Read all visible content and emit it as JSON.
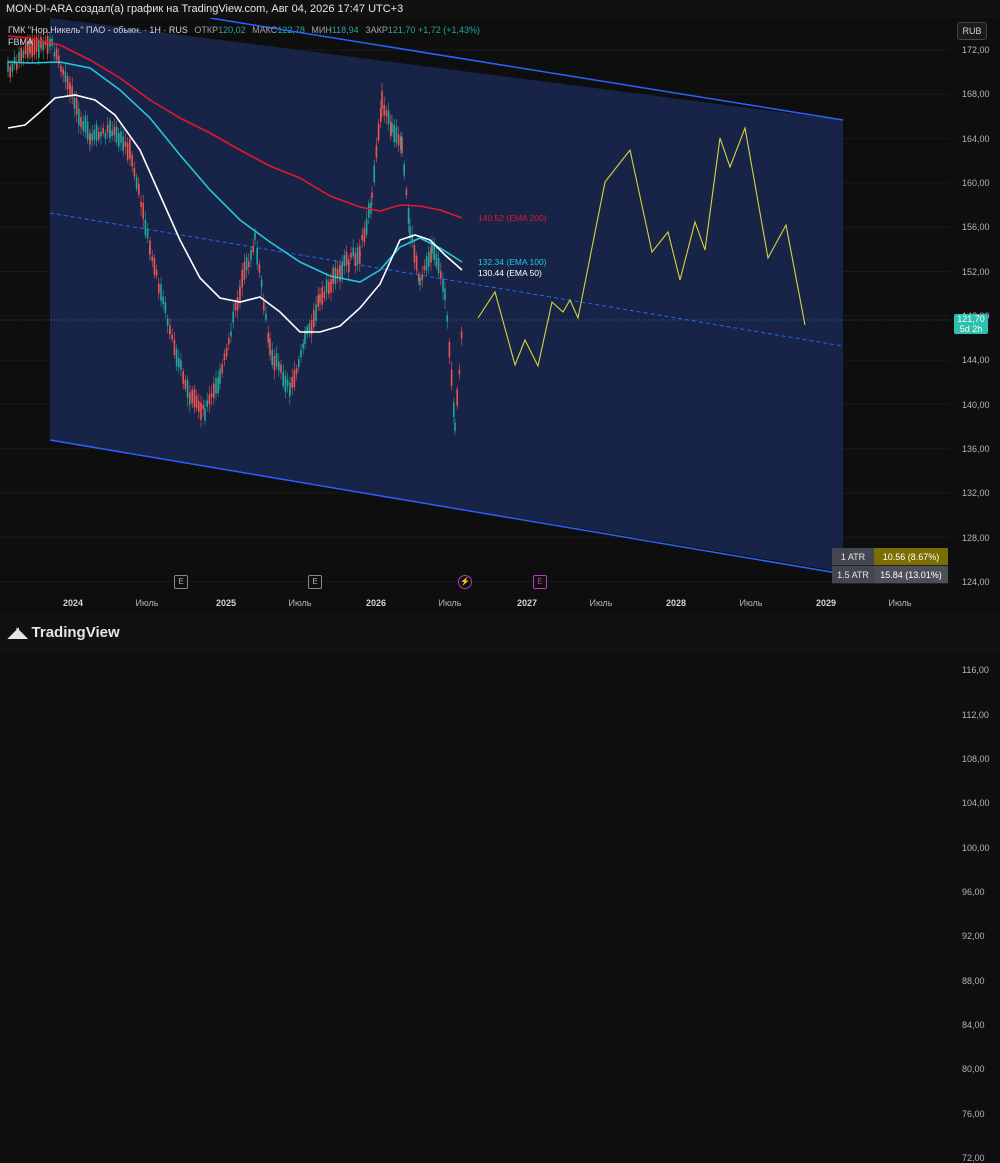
{
  "header": {
    "title": "MON-DI-ARA создал(а) график на TradingView.com, Авг 04, 2026 17:47 UTC+3"
  },
  "legend": {
    "symbol": "ГМК \"Нор.Никель\" ПАО - обыкн. · 1Н · RUS",
    "open_label": "ОТКР",
    "open": "120,02",
    "high_label": "МАКС",
    "high": "122,78",
    "low_label": "МИН",
    "low": "118,94",
    "close_label": "ЗАКР",
    "close": "121,70",
    "change": "+1,72 (+1,43%)",
    "indicator": "FBMA"
  },
  "currency_button": "RUB",
  "price_axis": [
    "172,00",
    "168,00",
    "164,00",
    "160,00",
    "156,00",
    "152,00",
    "148,00",
    "144,00",
    "140,00",
    "136,00",
    "132,00",
    "128,00",
    "124,00",
    "116,00",
    "112,00",
    "108,00",
    "104,00",
    "100,00",
    "96,00",
    "92,00",
    "88,00",
    "84,00",
    "80,00",
    "76,00",
    "72,00"
  ],
  "last_price": {
    "value": "121,70",
    "countdown": "5d 2h",
    "color": "#2ebfae"
  },
  "time_axis": [
    "2024",
    "Июль",
    "2025",
    "Июль",
    "2026",
    "Июль",
    "2027",
    "Июль",
    "2028",
    "Июль",
    "2029",
    "Июль"
  ],
  "ema_labels": {
    "ema200": "140.52 (EMA 200)",
    "ema100": "132.34 (EMA 100)",
    "ema50": "130.44 (EMA 50)"
  },
  "colors": {
    "ema200": "#e5172b",
    "ema100": "#26c6da",
    "ema50": "#ffffff",
    "channel": "#2962ff",
    "channel_fill": "#172447",
    "projection": "#d6d33a",
    "up": "#26a69a",
    "down": "#ef5350"
  },
  "events": [
    {
      "icon": "earnings-icon",
      "glyph": "E"
    },
    {
      "icon": "earnings-icon",
      "glyph": "E"
    },
    {
      "icon": "bolt-icon",
      "glyph": "⚡"
    },
    {
      "icon": "dividend-icon",
      "glyph": "E"
    }
  ],
  "atr": [
    {
      "name": "1 ATR",
      "value": "10.56 (8.67%)"
    },
    {
      "name": "1.5 ATR",
      "value": "15.84 (13.01%)"
    }
  ],
  "footer": {
    "brand": "TradingView",
    "logo_icon": "tradingview-logo-icon"
  }
}
